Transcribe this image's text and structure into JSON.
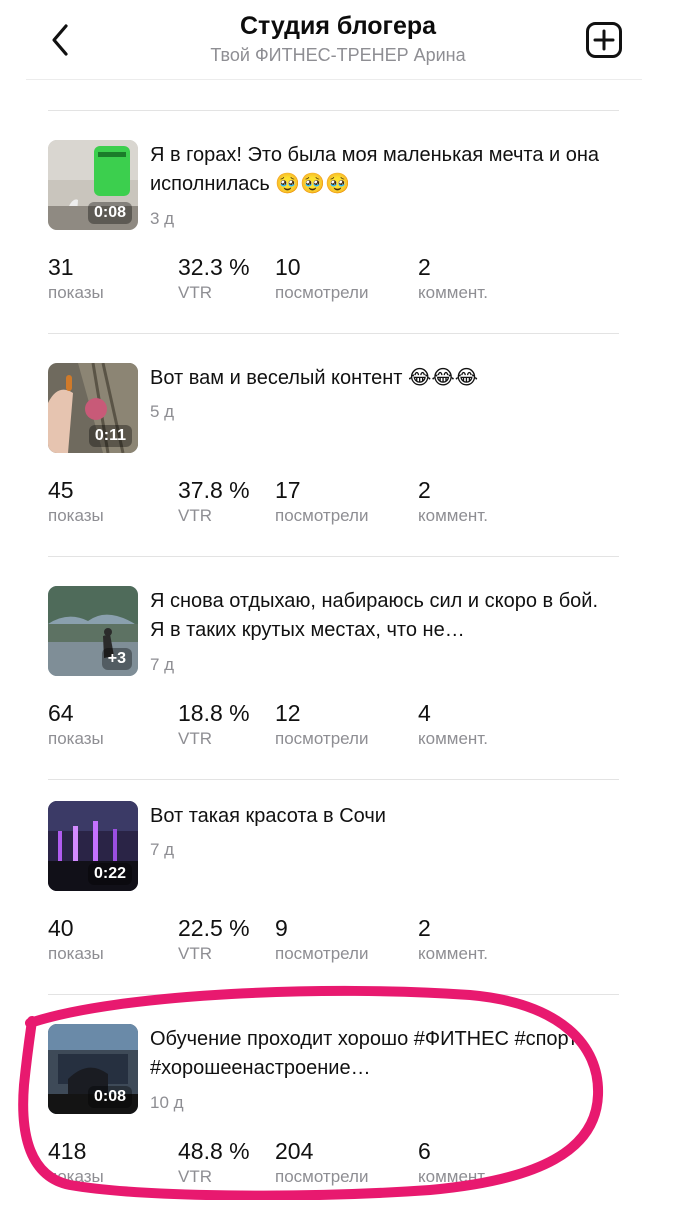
{
  "header": {
    "title": "Студия блогера",
    "subtitle": "Твой ФИТНЕС-ТРЕНЕР Арина",
    "back_icon": "chevron-left-icon",
    "add_icon": "plus-square-icon"
  },
  "posts": [
    {
      "text": "Я в горах! Это была моя маленькая мечта и она исполнилась 🥹🥹🥹",
      "age": "3 д",
      "duration": "0:08",
      "stats": {
        "shows": "31",
        "shows_label": "показы",
        "vtr": "32.3 %",
        "vtr_label": "VTR",
        "views": "10",
        "views_label": "посмотрели",
        "comments": "2",
        "comments_label": "коммент."
      }
    },
    {
      "text": "Вот вам и веселый контент 😂😂😂",
      "age": "5 д",
      "duration": "0:11",
      "stats": {
        "shows": "45",
        "shows_label": "показы",
        "vtr": "37.8 %",
        "vtr_label": "VTR",
        "views": "17",
        "views_label": "посмотрели",
        "comments": "2",
        "comments_label": "коммент."
      }
    },
    {
      "text": "Я снова отдыхаю, набираюсь сил и скоро в бой. Я в таких крутых местах, что не…",
      "age": "7 д",
      "duration": "+3",
      "stats": {
        "shows": "64",
        "shows_label": "показы",
        "vtr": "18.8 %",
        "vtr_label": "VTR",
        "views": "12",
        "views_label": "посмотрели",
        "comments": "4",
        "comments_label": "коммент."
      }
    },
    {
      "text": "Вот такая красота в Сочи",
      "age": "7 д",
      "duration": "0:22",
      "stats": {
        "shows": "40",
        "shows_label": "показы",
        "vtr": "22.5 %",
        "vtr_label": "VTR",
        "views": "9",
        "views_label": "посмотрели",
        "comments": "2",
        "comments_label": "коммент."
      }
    },
    {
      "text": "Обучение проходит хорошо #ФИТНЕС #спорт #хорошеенастроение…",
      "age": "10 д",
      "duration": "0:08",
      "stats": {
        "shows": "418",
        "shows_label": "показы",
        "vtr": "48.8 %",
        "vtr_label": "VTR",
        "views": "204",
        "views_label": "посмотрели",
        "comments": "6",
        "comments_label": "коммент."
      }
    }
  ],
  "colors": {
    "annotation": "#e8196f",
    "secondary_text": "#8e8e93"
  }
}
